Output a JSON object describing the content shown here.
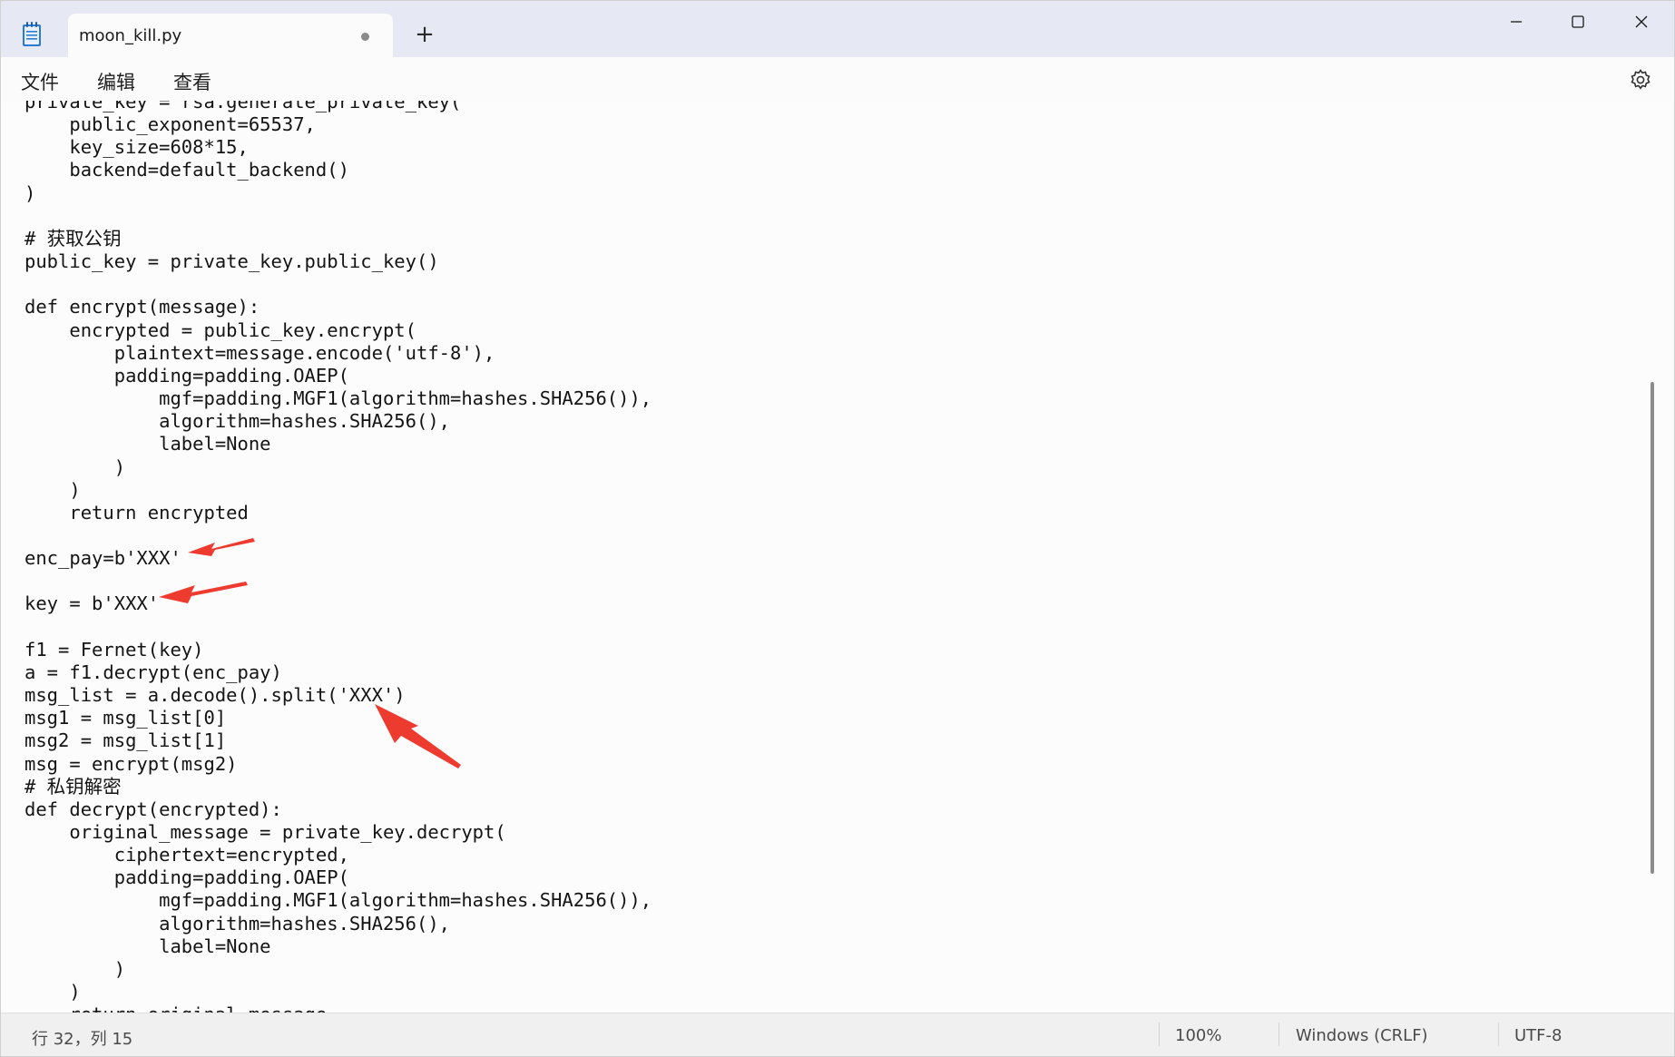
{
  "tab": {
    "title": "moon_kill.py"
  },
  "menu": {
    "file": "文件",
    "edit": "编辑",
    "view": "查看"
  },
  "editor": {
    "lines": [
      "private_key = rsa.generate_private_key(",
      "    public_exponent=65537,",
      "    key_size=608*15,",
      "    backend=default_backend()",
      ")",
      "",
      "# 获取公钥",
      "public_key = private_key.public_key()",
      "",
      "def encrypt(message):",
      "    encrypted = public_key.encrypt(",
      "        plaintext=message.encode('utf-8'),",
      "        padding=padding.OAEP(",
      "            mgf=padding.MGF1(algorithm=hashes.SHA256()),",
      "            algorithm=hashes.SHA256(),",
      "            label=None",
      "        )",
      "    )",
      "    return encrypted",
      "",
      "enc_pay=b'XXX'",
      "",
      "key = b'XXX'",
      "",
      "f1 = Fernet(key)",
      "a = f1.decrypt(enc_pay)",
      "msg_list = a.decode().split('XXX')",
      "msg1 = msg_list[0]",
      "msg2 = msg_list[1]",
      "msg = encrypt(msg2)",
      "# 私钥解密",
      "def decrypt(encrypted):",
      "    original_message = private_key.decrypt(",
      "        ciphertext=encrypted,",
      "        padding=padding.OAEP(",
      "            mgf=padding.MGF1(algorithm=hashes.SHA256()),",
      "            algorithm=hashes.SHA256(),",
      "            label=None",
      "        )",
      "    )",
      "    return original_message"
    ]
  },
  "status": {
    "position": "行 32，列 15",
    "zoom": "100%",
    "line_ending": "Windows (CRLF)",
    "encoding": "UTF-8"
  },
  "colors": {
    "annotation_arrow": "#ee3b2f"
  },
  "icons": {
    "app": "notepad-icon",
    "new_tab": "plus-icon",
    "minimize": "minimize-icon",
    "maximize": "maximize-icon",
    "close": "close-icon",
    "settings": "gear-icon"
  }
}
